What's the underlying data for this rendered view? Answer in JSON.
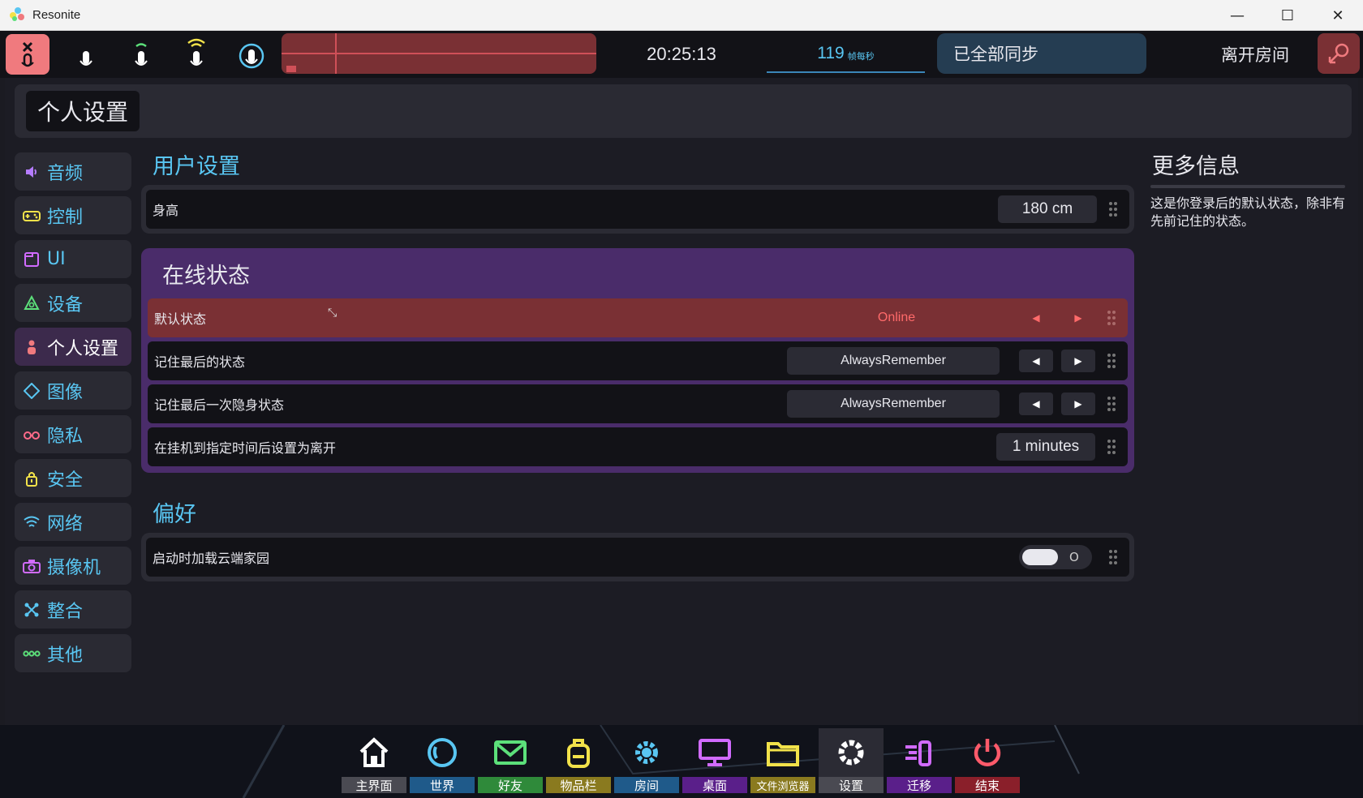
{
  "window": {
    "title": "Resonite",
    "minimize": "—",
    "maximize": "☐",
    "close": "✕"
  },
  "topbar": {
    "clock": "20:25:13",
    "fps_value": "119",
    "fps_unit": "帧每秒",
    "sync_status": "已全部同步",
    "leave_session": "离开房间"
  },
  "header": {
    "title": "个人设置"
  },
  "sidebar": {
    "items": [
      {
        "label": "音频",
        "icon": "speaker-icon",
        "color": "#b57cff"
      },
      {
        "label": "控制",
        "icon": "gamepad-icon",
        "color": "#f2e24a"
      },
      {
        "label": "UI",
        "icon": "window-icon",
        "color": "#d16bff"
      },
      {
        "label": "设备",
        "icon": "device-icon",
        "color": "#5ce07a"
      },
      {
        "label": "个人设置",
        "icon": "person-icon",
        "color": "#f07a7e"
      },
      {
        "label": "图像",
        "icon": "diamond-icon",
        "color": "#59c6f2"
      },
      {
        "label": "隐私",
        "icon": "glasses-icon",
        "color": "#ff6b8a"
      },
      {
        "label": "安全",
        "icon": "lock-icon",
        "color": "#f2e24a"
      },
      {
        "label": "网络",
        "icon": "wifi-icon",
        "color": "#59c6f2"
      },
      {
        "label": "摄像机",
        "icon": "camera-icon",
        "color": "#d16bff"
      },
      {
        "label": "整合",
        "icon": "integration-icon",
        "color": "#59c6f2"
      },
      {
        "label": "其他",
        "icon": "more-icon",
        "color": "#5ce07a"
      }
    ],
    "active_index": 4,
    "label_color": "#59c6f2"
  },
  "user_settings": {
    "title": "用户设置",
    "height_label": "身高",
    "height_value": "180 cm"
  },
  "online_status": {
    "title": "在线状态",
    "default_label": "默认状态",
    "default_value": "Online",
    "remember_last_label": "记住最后的状态",
    "remember_last_value": "AlwaysRemember",
    "remember_invisible_label": "记住最后一次隐身状态",
    "remember_invisible_value": "AlwaysRemember",
    "afk_label": "在挂机到指定时间后设置为离开",
    "afk_value": "1 minutes"
  },
  "preferences": {
    "title": "偏好",
    "cloud_home_label": "启动时加载云端家园",
    "cloud_home_state": "O"
  },
  "more_info": {
    "title": "更多信息",
    "text": "这是你登录后的默认状态，除非有先前记住的状态。"
  },
  "dock": [
    {
      "label": "主界面",
      "icon": "home-icon",
      "color": "#4a4a52",
      "icon_color": "#ffffff"
    },
    {
      "label": "世界",
      "icon": "world-icon",
      "color": "#1f5a8a",
      "icon_color": "#59c6f2"
    },
    {
      "label": "好友",
      "icon": "mail-icon",
      "color": "#2f8a3a",
      "icon_color": "#5ce07a"
    },
    {
      "label": "物品栏",
      "icon": "backpack-icon",
      "color": "#8a7a1f",
      "icon_color": "#f2e24a"
    },
    {
      "label": "房间",
      "icon": "gear-icon",
      "color": "#1f5a8a",
      "icon_color": "#59c6f2"
    },
    {
      "label": "桌面",
      "icon": "monitor-icon",
      "color": "#5a1f8a",
      "icon_color": "#d16bff"
    },
    {
      "label": "文件浏览器",
      "icon": "folder-icon",
      "color": "#8a7a1f",
      "icon_color": "#f2e24a"
    },
    {
      "label": "设置",
      "icon": "settings-icon",
      "color": "#4a4a52",
      "icon_color": "#ffffff"
    },
    {
      "label": "迁移",
      "icon": "migrate-icon",
      "color": "#5a1f8a",
      "icon_color": "#d16bff"
    },
    {
      "label": "结束",
      "icon": "power-icon",
      "color": "#8a1f2a",
      "icon_color": "#ff5a6a"
    }
  ],
  "colors": {
    "accent_blue": "#59c6f2",
    "highlight_red": "#7a3034",
    "status_purple": "#4a2c6a",
    "online_text": "#ff6a6a"
  }
}
